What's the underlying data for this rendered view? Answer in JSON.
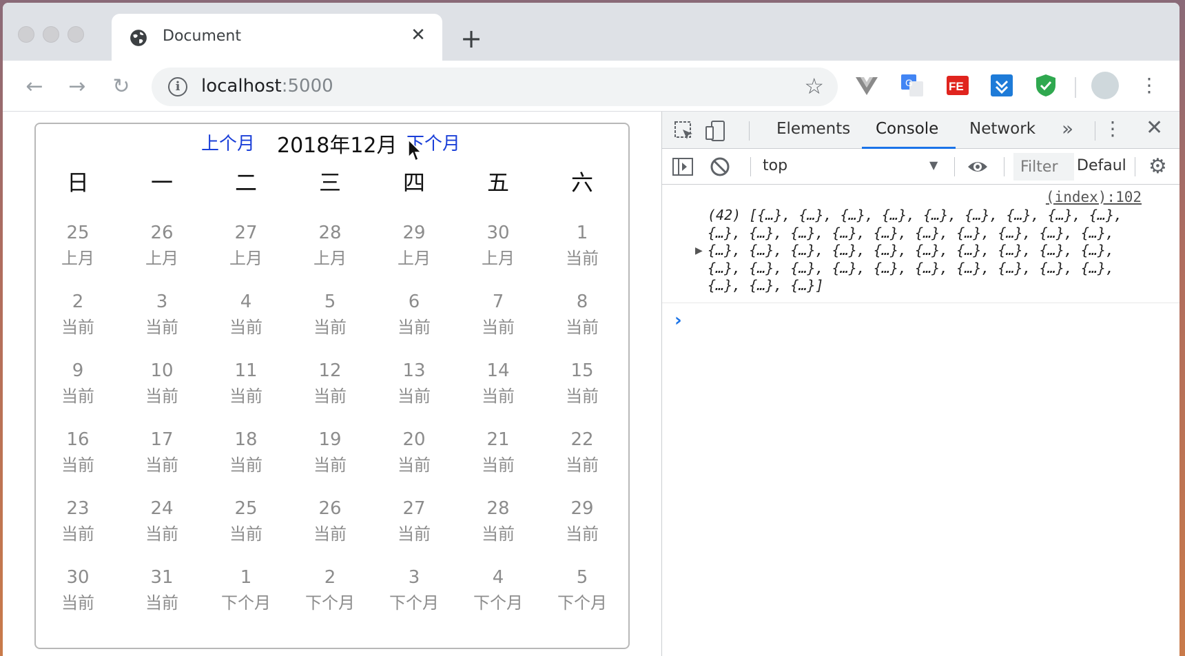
{
  "browser": {
    "tab_title": "Document",
    "url_host": "localhost",
    "url_port": ":5000"
  },
  "calendar": {
    "prev_label": "上个月",
    "title": "2018年12月",
    "next_label": "下个月",
    "weekdays": [
      "日",
      "一",
      "二",
      "三",
      "四",
      "五",
      "六"
    ],
    "weeks": [
      [
        {
          "n": "25",
          "t": "上月"
        },
        {
          "n": "26",
          "t": "上月"
        },
        {
          "n": "27",
          "t": "上月"
        },
        {
          "n": "28",
          "t": "上月"
        },
        {
          "n": "29",
          "t": "上月"
        },
        {
          "n": "30",
          "t": "上月"
        },
        {
          "n": "1",
          "t": "当前"
        }
      ],
      [
        {
          "n": "2",
          "t": "当前"
        },
        {
          "n": "3",
          "t": "当前"
        },
        {
          "n": "4",
          "t": "当前"
        },
        {
          "n": "5",
          "t": "当前"
        },
        {
          "n": "6",
          "t": "当前"
        },
        {
          "n": "7",
          "t": "当前"
        },
        {
          "n": "8",
          "t": "当前"
        }
      ],
      [
        {
          "n": "9",
          "t": "当前"
        },
        {
          "n": "10",
          "t": "当前"
        },
        {
          "n": "11",
          "t": "当前"
        },
        {
          "n": "12",
          "t": "当前"
        },
        {
          "n": "13",
          "t": "当前"
        },
        {
          "n": "14",
          "t": "当前"
        },
        {
          "n": "15",
          "t": "当前"
        }
      ],
      [
        {
          "n": "16",
          "t": "当前"
        },
        {
          "n": "17",
          "t": "当前"
        },
        {
          "n": "18",
          "t": "当前"
        },
        {
          "n": "19",
          "t": "当前"
        },
        {
          "n": "20",
          "t": "当前"
        },
        {
          "n": "21",
          "t": "当前"
        },
        {
          "n": "22",
          "t": "当前"
        }
      ],
      [
        {
          "n": "23",
          "t": "当前"
        },
        {
          "n": "24",
          "t": "当前"
        },
        {
          "n": "25",
          "t": "当前"
        },
        {
          "n": "26",
          "t": "当前"
        },
        {
          "n": "27",
          "t": "当前"
        },
        {
          "n": "28",
          "t": "当前"
        },
        {
          "n": "29",
          "t": "当前"
        }
      ],
      [
        {
          "n": "30",
          "t": "当前"
        },
        {
          "n": "31",
          "t": "当前"
        },
        {
          "n": "1",
          "t": "下个月"
        },
        {
          "n": "2",
          "t": "下个月"
        },
        {
          "n": "3",
          "t": "下个月"
        },
        {
          "n": "4",
          "t": "下个月"
        },
        {
          "n": "5",
          "t": "下个月"
        }
      ]
    ]
  },
  "devtools": {
    "tabs": [
      "Elements",
      "Console",
      "Network"
    ],
    "active_tab": "Console",
    "context": "top",
    "filter_placeholder": "Filter",
    "levels_label": "Defaul",
    "source_link": "(index):102",
    "message": "(42) [{…}, {…}, {…}, {…}, {…}, {…}, {…}, {…}, {…}, {…}, {…}, {…}, {…}, {…}, {…}, {…}, {…}, {…}, {…}, {…}, {…}, {…}, {…}, {…}, {…}, {…}, {…}, {…}, {…}, {…}, {…}, {…}, {…}, {…}, {…}, {…}, {…}, {…}, {…}, {…}, {…}, {…}]"
  },
  "colors": {
    "link_blue": "#1a3fd8",
    "devtools_accent": "#1a73e8"
  }
}
